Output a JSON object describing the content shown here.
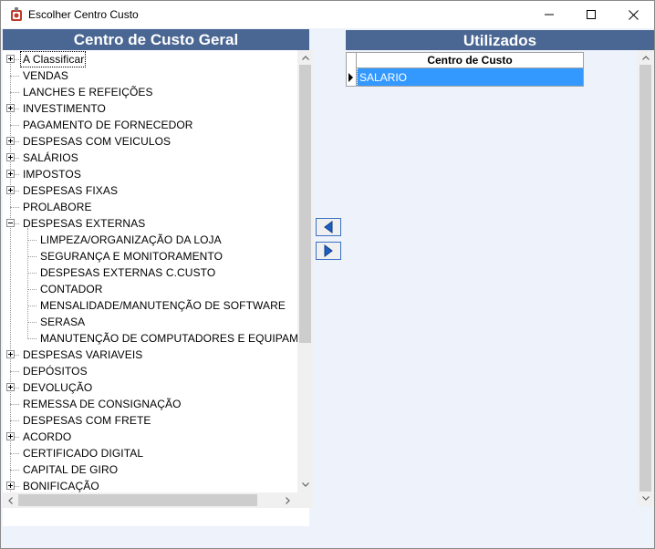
{
  "window": {
    "title": "Escolher Centro Custo",
    "icon": "app-puzzle-icon"
  },
  "left_panel": {
    "header": "Centro de Custo Geral",
    "tree": [
      {
        "label": "A Classificar",
        "level": 0,
        "expander": "plus",
        "selected": true
      },
      {
        "label": "VENDAS",
        "level": 0,
        "expander": "none"
      },
      {
        "label": "LANCHES E REFEIÇÕES",
        "level": 0,
        "expander": "none"
      },
      {
        "label": "INVESTIMENTO",
        "level": 0,
        "expander": "plus"
      },
      {
        "label": "PAGAMENTO DE FORNECEDOR",
        "level": 0,
        "expander": "none"
      },
      {
        "label": "DESPESAS COM VEICULOS",
        "level": 0,
        "expander": "plus"
      },
      {
        "label": "SALÁRIOS",
        "level": 0,
        "expander": "plus"
      },
      {
        "label": "IMPOSTOS",
        "level": 0,
        "expander": "plus"
      },
      {
        "label": "DESPESAS FIXAS",
        "level": 0,
        "expander": "plus"
      },
      {
        "label": "PROLABORE",
        "level": 0,
        "expander": "none"
      },
      {
        "label": "DESPESAS EXTERNAS",
        "level": 0,
        "expander": "minus"
      },
      {
        "label": "LIMPEZA/ORGANIZAÇÃO DA LOJA",
        "level": 1,
        "expander": "none"
      },
      {
        "label": "SEGURANÇA E MONITORAMENTO",
        "level": 1,
        "expander": "none"
      },
      {
        "label": "DESPESAS EXTERNAS  C.CUSTO",
        "level": 1,
        "expander": "none"
      },
      {
        "label": "CONTADOR",
        "level": 1,
        "expander": "none"
      },
      {
        "label": "MENSALIDADE/MANUTENÇÃO DE SOFTWARE",
        "level": 1,
        "expander": "none"
      },
      {
        "label": "SERASA",
        "level": 1,
        "expander": "none"
      },
      {
        "label": "MANUTENÇÃO DE COMPUTADORES E EQUIPAMENTOS",
        "level": 1,
        "expander": "none"
      },
      {
        "label": "DESPESAS VARIAVEIS",
        "level": 0,
        "expander": "plus"
      },
      {
        "label": "DEPÓSITOS",
        "level": 0,
        "expander": "none"
      },
      {
        "label": "DEVOLUÇÃO",
        "level": 0,
        "expander": "plus"
      },
      {
        "label": "REMESSA DE CONSIGNAÇÃO",
        "level": 0,
        "expander": "none"
      },
      {
        "label": "DESPESAS COM FRETE",
        "level": 0,
        "expander": "none"
      },
      {
        "label": "ACORDO",
        "level": 0,
        "expander": "plus"
      },
      {
        "label": "CERTIFICADO DIGITAL",
        "level": 0,
        "expander": "none"
      },
      {
        "label": "CAPITAL DE GIRO",
        "level": 0,
        "expander": "none"
      },
      {
        "label": "BONIFICAÇÃO",
        "level": 0,
        "expander": "plus"
      }
    ]
  },
  "transfer_buttons": {
    "move_left_icon": "arrow-left-icon",
    "move_right_icon": "arrow-right-icon"
  },
  "right_panel": {
    "header": "Utilizados",
    "column_header": "Centro de Custo",
    "rows": [
      {
        "value": "SALARIO",
        "selected": true
      }
    ]
  },
  "colors": {
    "header_bg": "#4a6692",
    "selection": "#3399ff",
    "client_bg": "#edf2fb"
  }
}
